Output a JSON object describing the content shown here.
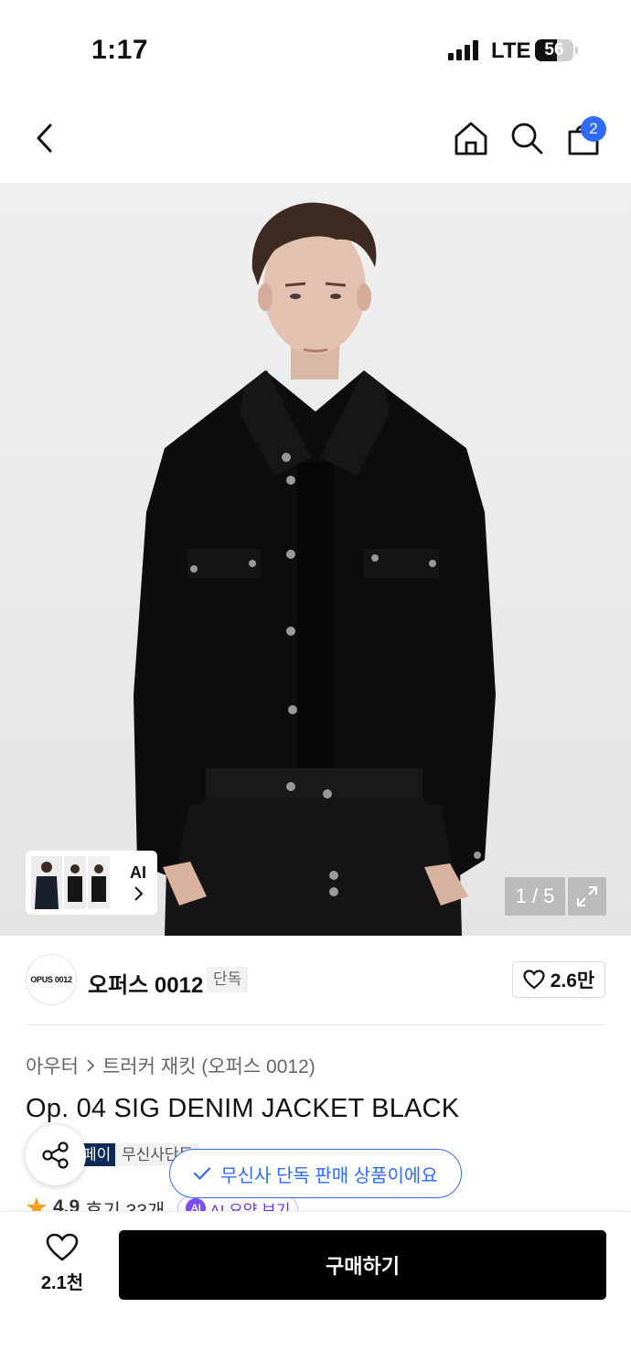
{
  "status_bar": {
    "time": "1:17",
    "network": "LTE",
    "battery": "56",
    "battery_level": 0.56
  },
  "nav": {
    "cart_badge": "2"
  },
  "gallery": {
    "counter": "1 / 5",
    "ai_label": "AI"
  },
  "brand": {
    "logo_text": "OPUS 0012",
    "name": "오퍼스 0012",
    "tag": "단독",
    "like_count": "2.6만"
  },
  "breadcrumb": {
    "category": "아우터",
    "subcategory": "트러커 재킷 (오퍼스 0012)"
  },
  "product": {
    "title": "Op. 04 SIG DENIM JACKET BLACK"
  },
  "badges": {
    "dark": "페이",
    "light": "무신사단독"
  },
  "toast": {
    "text": "무신사 단독 판매 상품이에요"
  },
  "rating": {
    "score": "4.9",
    "reviews": "후기 33개",
    "ai_summary": "AI 요약 보기",
    "ai_icon": "AI"
  },
  "bottom": {
    "wish_count": "2.1천",
    "buy_label": "구매하기"
  },
  "colors": {
    "accent": "#2f6bff",
    "buy_button": "#000000",
    "badge_dark": "#0e2a57",
    "star": "#f7a21b"
  }
}
